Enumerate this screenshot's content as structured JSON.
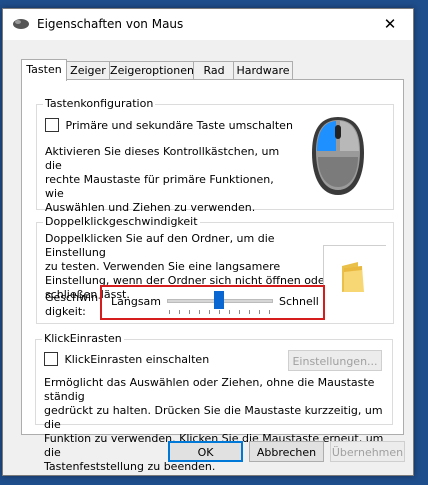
{
  "window": {
    "title": "Eigenschaften von Maus",
    "close_glyph": "✕"
  },
  "tabs": [
    {
      "label": "Tasten",
      "active": true
    },
    {
      "label": "Zeiger",
      "active": false
    },
    {
      "label": "Zeigeroptionen",
      "active": false
    },
    {
      "label": "Rad",
      "active": false
    },
    {
      "label": "Hardware",
      "active": false
    }
  ],
  "tastenkonfiguration": {
    "title": "Tastenkonfiguration",
    "checkbox_label": "Primäre und sekundäre Taste umschalten",
    "checked": false,
    "description": [
      "Aktivieren Sie dieses Kontrollkästchen, um die",
      "rechte Maustaste für primäre Funktionen, wie",
      "Auswählen und Ziehen zu verwenden."
    ],
    "icon": "mouse-icon"
  },
  "doppelklick": {
    "title": "Doppelklickgeschwindigkeit",
    "description": [
      "Doppelklicken Sie auf den Ordner, um die Einstellung",
      "zu testen. Verwenden Sie eine langsamere",
      "Einstellung, wenn der Ordner sich nicht öffnen oder",
      "schließen lässt."
    ],
    "speed_label": [
      "Geschwin-",
      "digkeit:"
    ],
    "slow_label": "Langsam",
    "fast_label": "Schnell",
    "speed_value": 0.5,
    "folder_icon": "folder-icon",
    "highlight_color": "#d51d1d"
  },
  "klickeinrasten": {
    "title": "KlickEinrasten",
    "checkbox_label": "KlickEinrasten einschalten",
    "checked": false,
    "settings_button": "Einstellungen...",
    "description": [
      "Ermöglicht das Auswählen oder Ziehen, ohne die Maustaste ständig",
      "gedrückt zu halten. Drücken Sie die Maustaste kurzzeitig, um die",
      "Funktion zu verwenden. Klicken Sie die Maustaste erneut, um die",
      "Tastenfeststellung zu beenden."
    ]
  },
  "buttons": {
    "ok": "OK",
    "cancel": "Abbrechen",
    "apply": "Übernehmen"
  },
  "colors": {
    "accent": "#0a66d1",
    "mouse_highlight": "#1e90ff"
  }
}
